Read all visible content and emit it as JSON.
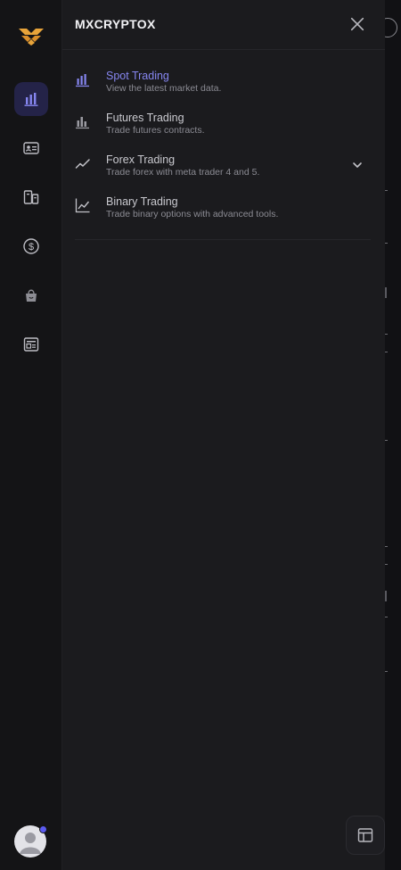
{
  "app": {
    "brand": "MXCRYPTOX"
  },
  "rail": {
    "items": [
      {
        "icon": "bar-chart-icon",
        "active": true
      },
      {
        "icon": "id-card-icon",
        "active": false
      },
      {
        "icon": "devices-icon",
        "active": false
      },
      {
        "icon": "dollar-circle-icon",
        "active": false
      },
      {
        "icon": "shopping-bag-icon",
        "active": false
      },
      {
        "icon": "news-icon",
        "active": false
      }
    ]
  },
  "menu": {
    "items": [
      {
        "title": "Spot Trading",
        "desc": "View the latest market data.",
        "icon": "bars-icon",
        "active": true
      },
      {
        "title": "Futures Trading",
        "desc": "Trade futures contracts.",
        "icon": "bars-icon",
        "active": false
      },
      {
        "title": "Forex Trading",
        "desc": "Trade forex with meta trader 4 and 5.",
        "icon": "trend-line-icon",
        "active": false,
        "expandable": true
      },
      {
        "title": "Binary Trading",
        "desc": "Trade binary options with advanced tools.",
        "icon": "line-chart-icon",
        "active": false
      }
    ]
  },
  "colors": {
    "accent": "#8686f0",
    "active_bg": "#242348",
    "panel_bg": "#1b1b1e",
    "rail_bg": "#141416",
    "logo_gold": "#e8a43a"
  }
}
